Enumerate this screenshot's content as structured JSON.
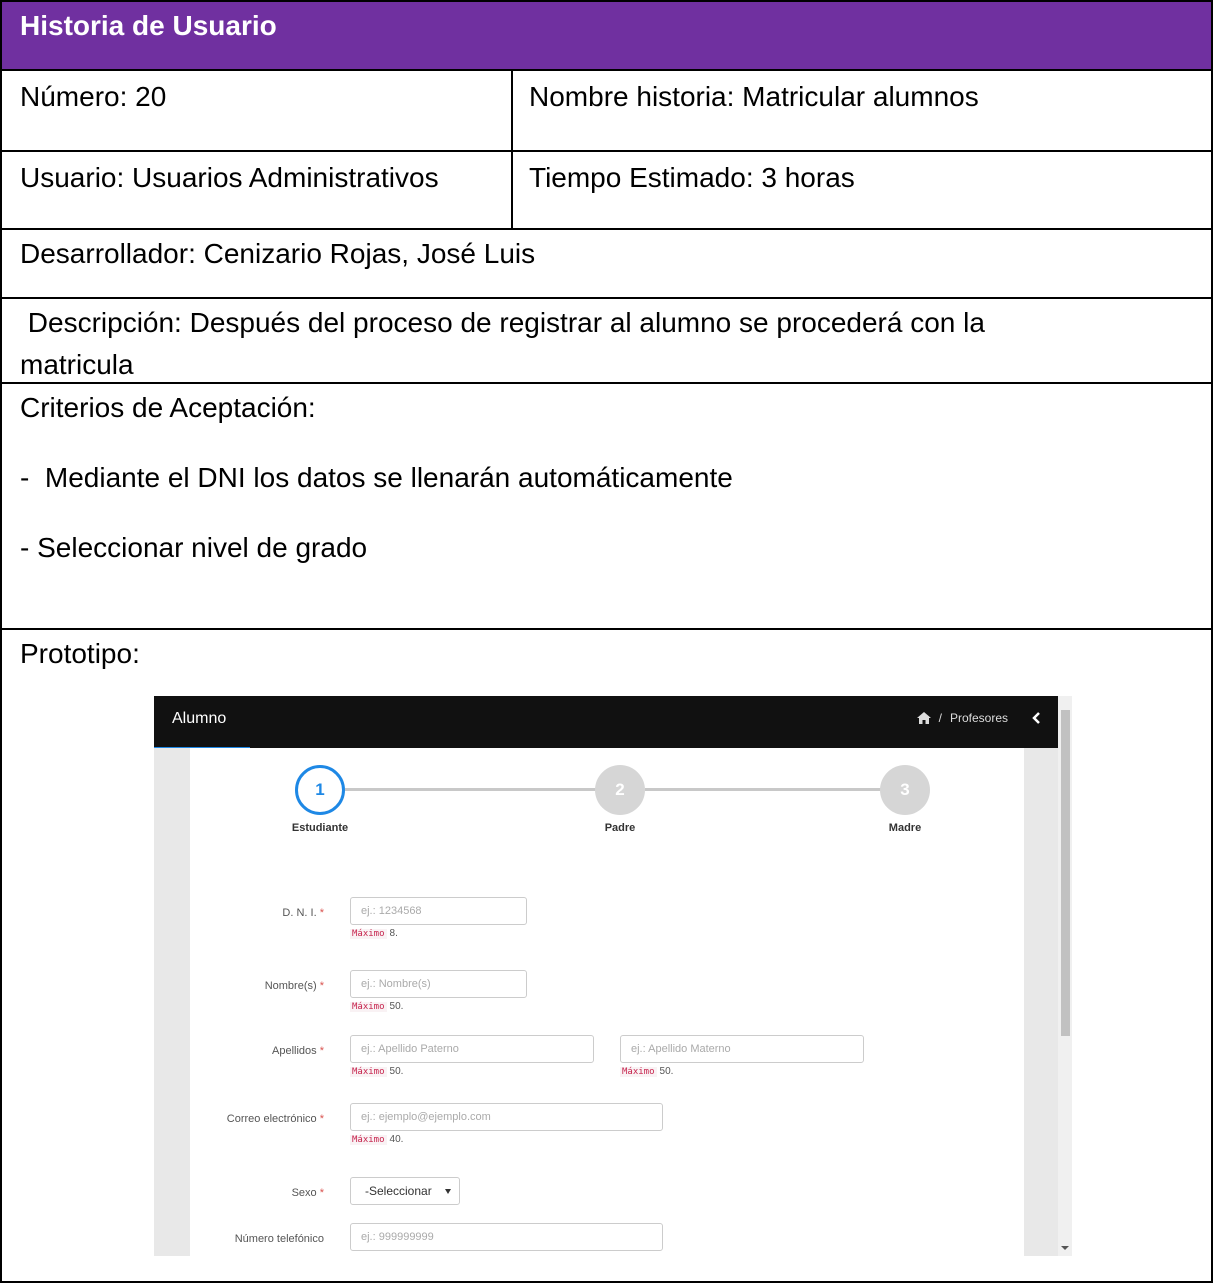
{
  "header": {
    "title": "Historia de Usuario"
  },
  "numero": "Número: 20",
  "nombre_historia": "Nombre historia: Matricular alumnos",
  "usuario": "Usuario: Usuarios Administrativos",
  "tiempo": "Tiempo Estimado: 3 horas",
  "desarrollador": "Desarrollador:   Cenizario Rojas, José Luis",
  "descripcion": {
    "line1": " Descripción: Después del proceso de registrar al alumno se procederá con la",
    "line2": "matricula"
  },
  "criterios": {
    "heading": "Criterios de Aceptación:",
    "items": [
      "-  Mediante el DNI los datos se llenarán automáticamente",
      "- Seleccionar nivel de grado"
    ]
  },
  "prototipo_label": "Prototipo:",
  "prototype": {
    "title": "Alumno",
    "breadcrumb": "Profesores",
    "icons": {
      "home": "home-icon",
      "collapse": "chevron-left-icon"
    },
    "accent_color": "#1e88e5",
    "steps": [
      {
        "number": "1",
        "label": "Estudiante"
      },
      {
        "number": "2",
        "label": "Padre"
      },
      {
        "number": "3",
        "label": "Madre"
      }
    ],
    "required_mark": "*",
    "max_word": "Máximo",
    "fields": {
      "dni": {
        "label": "D. N. I.",
        "placeholder": "ej.: 1234568",
        "max": "8."
      },
      "nombre": {
        "label": "Nombre(s)",
        "placeholder": "ej.: Nombre(s)",
        "max": "50."
      },
      "apellidos": {
        "label": "Apellidos",
        "placeholder_paterno": "ej.: Apellido Paterno",
        "placeholder_materno": "ej.: Apellido Materno",
        "max": "50."
      },
      "correo": {
        "label": "Correo electrónico",
        "placeholder": "ej.: ejemplo@ejemplo.com",
        "max": "40."
      },
      "sexo": {
        "label": "Sexo",
        "selected": "-Seleccionar"
      },
      "telefono": {
        "label": "Número telefónico",
        "placeholder": "ej.: 999999999"
      }
    }
  }
}
